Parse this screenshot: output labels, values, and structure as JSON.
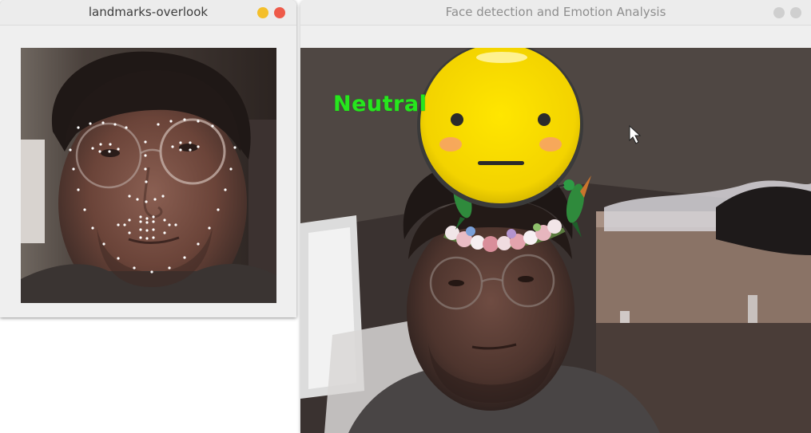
{
  "windows": [
    {
      "title": "landmarks-overlook",
      "state": "active",
      "buttons": [
        {
          "icon": "minimize-icon",
          "color": "#f4bf2a"
        },
        {
          "icon": "close-icon",
          "color": "#ee5a49"
        }
      ]
    },
    {
      "title": "Face detection and Emotion Analysis",
      "state": "inactive",
      "buttons": [
        {
          "icon": "minimize-icon",
          "color": "#cfcfcf"
        },
        {
          "icon": "close-icon",
          "color": "#cfcfcf"
        }
      ]
    }
  ],
  "camera": {
    "emotion_label": "Neutral",
    "emotion_label_color": "#27e61e",
    "overlay": {
      "emoji": "neutral-face-emoji",
      "headpiece": "flower-crown-with-hummingbirds"
    },
    "cursor": "arrow-cursor-icon"
  },
  "landmarks": {
    "point_color": "#ffffff",
    "point_count": 68
  }
}
